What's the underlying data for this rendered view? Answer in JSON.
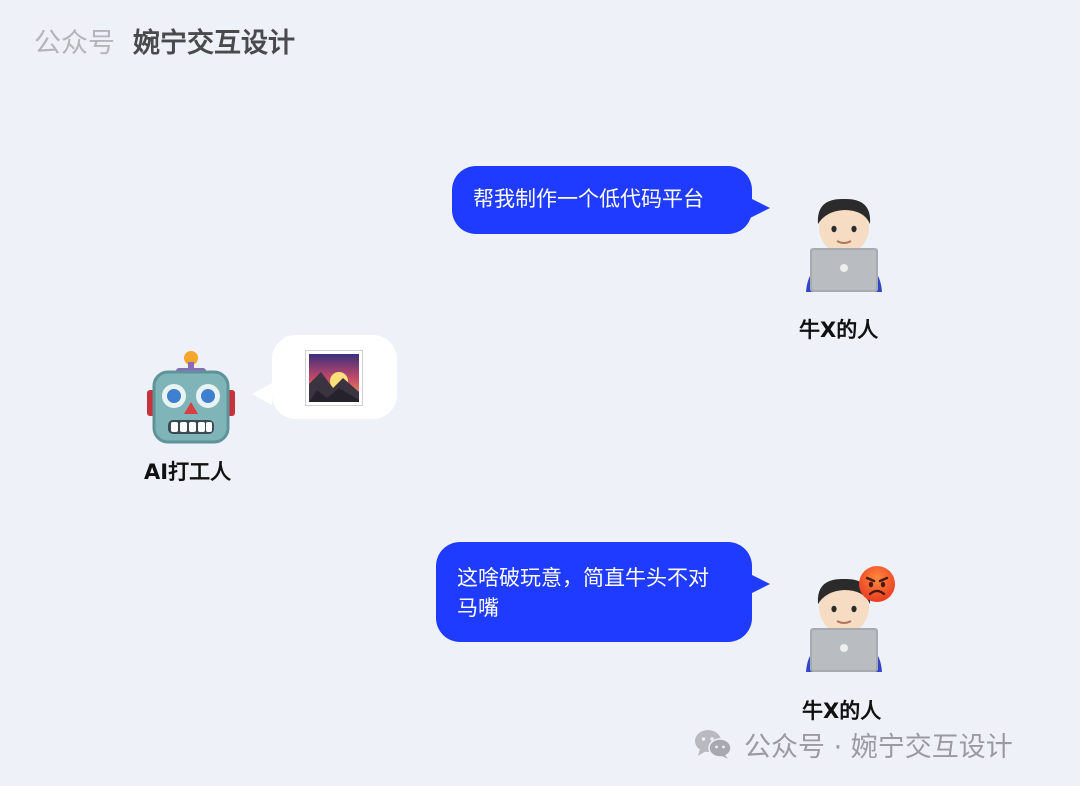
{
  "header": {
    "label": "公众号",
    "name": "婉宁交互设计"
  },
  "messages": [
    {
      "sender": "牛X的人",
      "text": "帮我制作一个低代码平台"
    },
    {
      "sender": "AI打工人",
      "image_icon": "sunrise-over-mountains-icon"
    },
    {
      "sender": "牛X的人",
      "text": "这啥破玩意，简直牛头不对马嘴",
      "reaction_icon": "angry-face-icon"
    }
  ],
  "avatars": {
    "human": {
      "icon": "technologist-with-laptop-icon",
      "caption": "牛X的人"
    },
    "robot": {
      "icon": "robot-face-icon",
      "caption": "AI打工人"
    }
  },
  "footer": {
    "icon": "wechat-icon",
    "text": "公众号 · 婉宁交互设计"
  },
  "colors": {
    "background": "#eef1f8",
    "bubble_blue": "#1f3bff",
    "bubble_white": "#ffffff"
  }
}
